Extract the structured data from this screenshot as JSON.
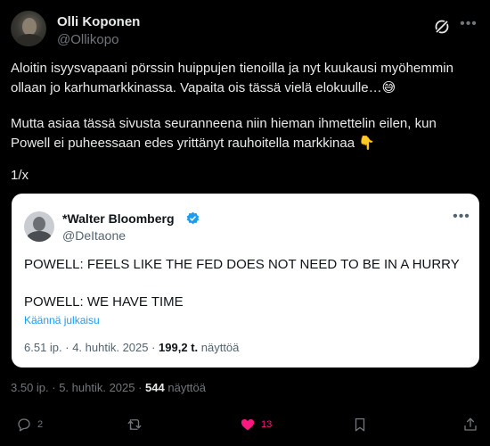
{
  "author": {
    "name": "Olli Koponen",
    "handle": "@Ollikopo"
  },
  "tweet": {
    "paragraph1": "Aloitin isyysvapaani pörssin huippujen tienoilla ja nyt kuukausi myöhemmin ollaan jo karhumarkkinassa. Vapaita ois tässä vielä elokuulle…😅",
    "paragraph2": "Mutta asiaa tässä sivusta seuranneena niin hieman ihmettelin eilen, kun Powell ei puheessaan edes yrittänyt rauhoitella markkinaa 👇",
    "paragraph3": "1/x"
  },
  "quote": {
    "name": "*Walter Bloomberg",
    "handle": "@DeItaone",
    "line1": "POWELL: FEELS LIKE THE FED DOES NOT NEED TO BE IN A HURRY",
    "line2": "POWELL: WE HAVE TIME",
    "translate": "Käännä julkaisu",
    "time": "6.51 ip. · 4. huhtik. 2025 · ",
    "views_count": "199,2 t.",
    "views_label": " näyttöä"
  },
  "meta": {
    "time": "3.50 ip. · 5. huhtik. 2025 · ",
    "views_count": "544",
    "views_label": " näyttöä"
  },
  "actions": {
    "reply_count": "2",
    "like_count": "13"
  },
  "colors": {
    "background": "#000000",
    "accent": "#1d9bf0",
    "like": "#f91880"
  },
  "icons": [
    "grok-icon",
    "more-icon",
    "verified-icon",
    "reply-icon",
    "retweet-icon",
    "heart-icon",
    "bookmark-icon",
    "share-icon"
  ]
}
